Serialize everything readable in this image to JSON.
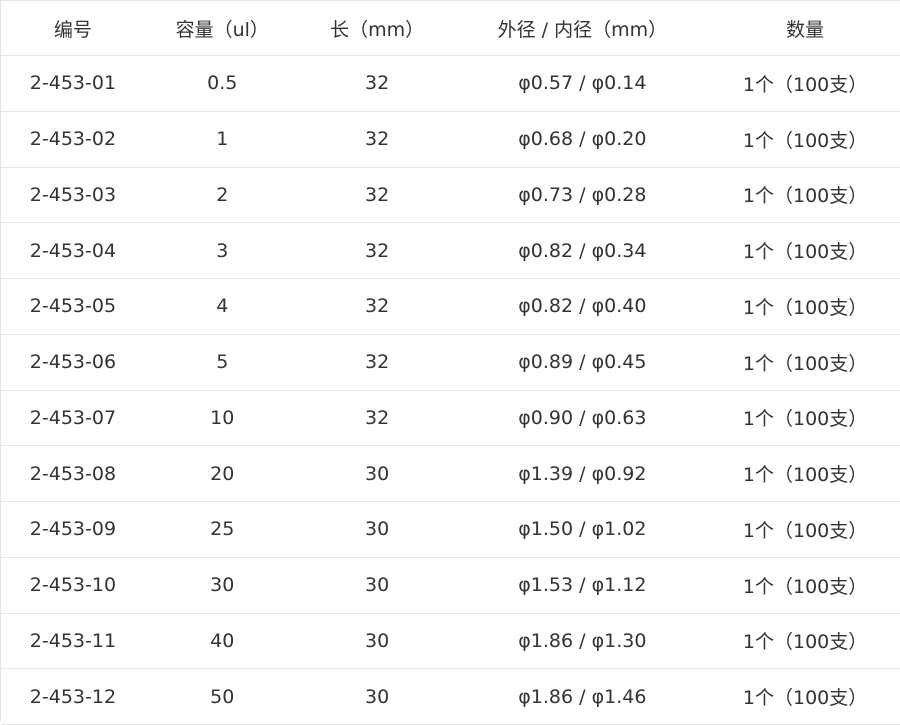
{
  "table": {
    "headers": [
      "编号",
      "容量（ul）",
      "长（mm）",
      "外径 / 内径（mm）",
      "数量"
    ],
    "rows": [
      [
        "2-453-01",
        "0.5",
        "32",
        "φ0.57 / φ0.14",
        "1个（100支）"
      ],
      [
        "2-453-02",
        "1",
        "32",
        "φ0.68 / φ0.20",
        "1个（100支）"
      ],
      [
        "2-453-03",
        "2",
        "32",
        "φ0.73 / φ0.28",
        "1个（100支）"
      ],
      [
        "2-453-04",
        "3",
        "32",
        "φ0.82 / φ0.34",
        "1个（100支）"
      ],
      [
        "2-453-05",
        "4",
        "32",
        "φ0.82 / φ0.40",
        "1个（100支）"
      ],
      [
        "2-453-06",
        "5",
        "32",
        "φ0.89 / φ0.45",
        "1个（100支）"
      ],
      [
        "2-453-07",
        "10",
        "32",
        "φ0.90 / φ0.63",
        "1个（100支）"
      ],
      [
        "2-453-08",
        "20",
        "30",
        "φ1.39 / φ0.92",
        "1个（100支）"
      ],
      [
        "2-453-09",
        "25",
        "30",
        "φ1.50 / φ1.02",
        "1个（100支）"
      ],
      [
        "2-453-10",
        "30",
        "30",
        "φ1.53 / φ1.12",
        "1个（100支）"
      ],
      [
        "2-453-11",
        "40",
        "30",
        "φ1.86 / φ1.30",
        "1个（100支）"
      ],
      [
        "2-453-12",
        "50",
        "30",
        "φ1.86 / φ1.46",
        "1个（100支）"
      ]
    ]
  }
}
